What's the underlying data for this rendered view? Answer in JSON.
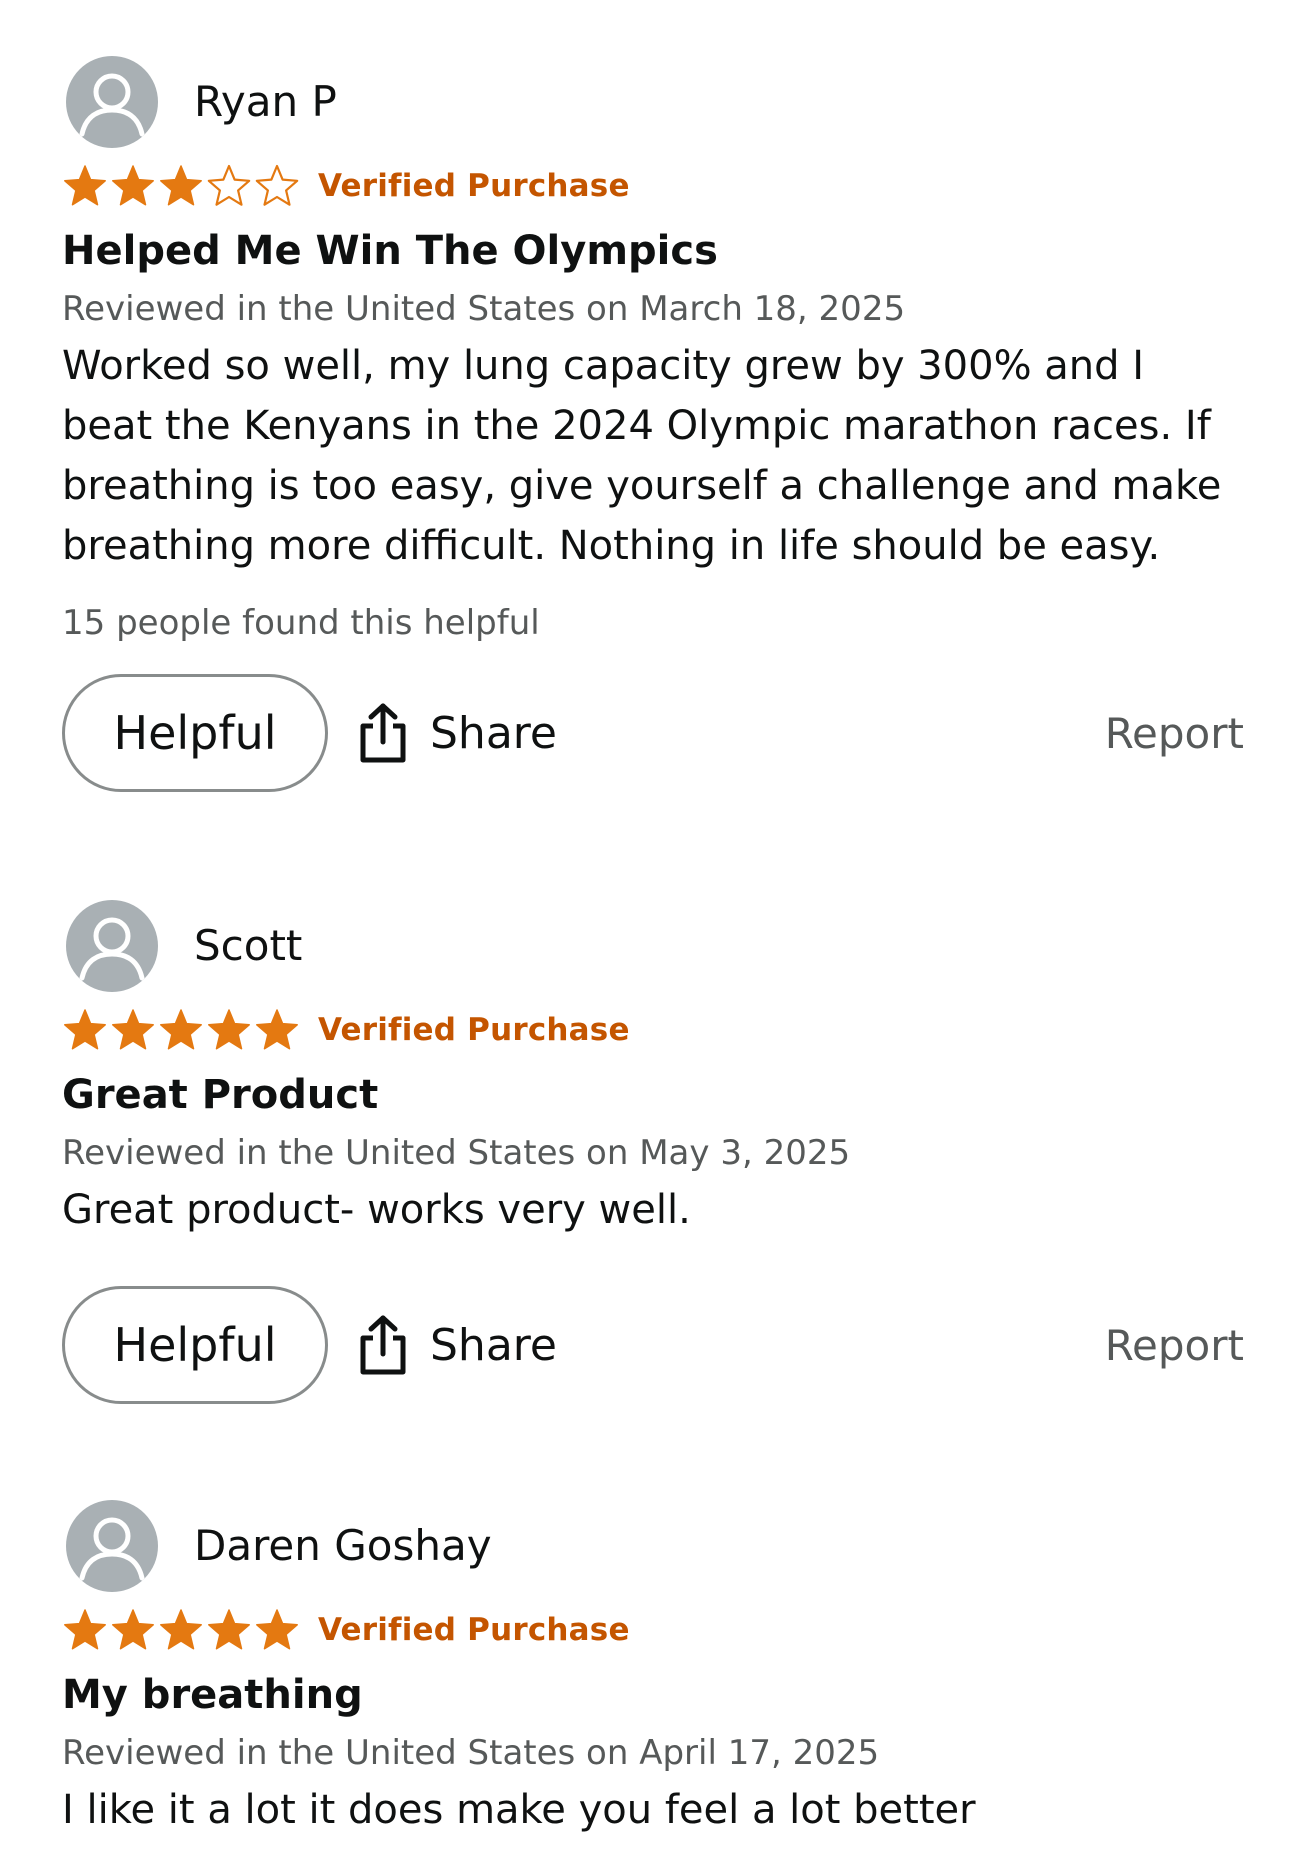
{
  "colors": {
    "star": "#e47911",
    "verified": "#c45500",
    "muted_text": "#565959",
    "text": "#0f1111",
    "avatar_bg": "#a9b0b4"
  },
  "reviews": [
    {
      "reviewer": "Ryan P",
      "rating": 3,
      "max_rating": 5,
      "verified_label": "Verified Purchase",
      "title": "Helped Me Win The Olympics",
      "date": "Reviewed in the United States on March 18, 2025",
      "body": "Worked so well, my lung capacity grew by 300% and I beat the Kenyans in the 2024 Olympic marathon races. If breathing is too easy, give yourself a challenge and make breathing more difficult. Nothing in life should be easy.",
      "helpful_count": "15 people found this helpful",
      "helpful_label": "Helpful",
      "share_label": "Share",
      "report_label": "Report"
    },
    {
      "reviewer": "Scott",
      "rating": 5,
      "max_rating": 5,
      "verified_label": "Verified Purchase",
      "title": "Great Product",
      "date": "Reviewed in the United States on May 3, 2025",
      "body": "Great product- works very well.",
      "helpful_label": "Helpful",
      "share_label": "Share",
      "report_label": "Report"
    },
    {
      "reviewer": "Daren Goshay",
      "rating": 5,
      "max_rating": 5,
      "verified_label": "Verified Purchase",
      "title": "My breathing",
      "date": "Reviewed in the United States on April 17, 2025",
      "body": "I like it a lot it does make you feel a lot better"
    }
  ]
}
